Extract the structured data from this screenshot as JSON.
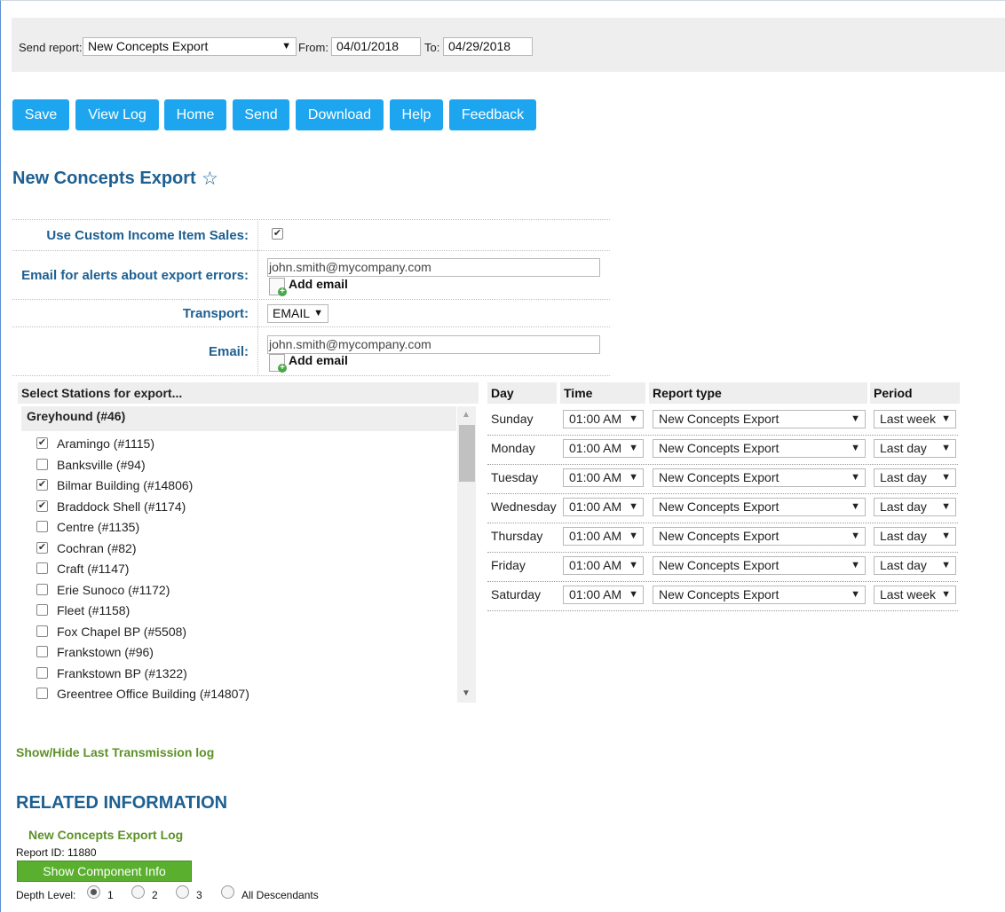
{
  "filter": {
    "send_label": "Send report:",
    "report_value": "New Concepts Export",
    "from_label": "From:",
    "from_value": "04/01/2018",
    "to_label": "To:",
    "to_value": "04/29/2018"
  },
  "toolbar": {
    "save": "Save",
    "view_log": "View Log",
    "home": "Home",
    "send": "Send",
    "download": "Download",
    "help": "Help",
    "feedback": "Feedback"
  },
  "page_title": "New Concepts Export",
  "star_glyph": "☆",
  "form": {
    "custom_income_label": "Use Custom Income Item Sales:",
    "custom_income_checked": true,
    "alert_email_label": "Email for alerts about export errors:",
    "alert_email_value": "john.smith@mycompany.com",
    "add_email": "Add email",
    "transport_label": "Transport:",
    "transport_value": "EMAIL",
    "email_label": "Email:",
    "email_value": "john.smith@mycompany.com"
  },
  "stations": {
    "header": "Select Stations for export...",
    "group": "Greyhound (#46)",
    "items": [
      {
        "label": "Aramingo (#1115)",
        "checked": true
      },
      {
        "label": "Banksville (#94)",
        "checked": false
      },
      {
        "label": "Bilmar Building (#14806)",
        "checked": true
      },
      {
        "label": "Braddock Shell (#1174)",
        "checked": true
      },
      {
        "label": "Centre (#1135)",
        "checked": false
      },
      {
        "label": "Cochran (#82)",
        "checked": true
      },
      {
        "label": "Craft (#1147)",
        "checked": false
      },
      {
        "label": "Erie Sunoco (#1172)",
        "checked": false
      },
      {
        "label": "Fleet (#1158)",
        "checked": false
      },
      {
        "label": "Fox Chapel BP (#5508)",
        "checked": false
      },
      {
        "label": "Frankstown (#96)",
        "checked": false
      },
      {
        "label": "Frankstown BP (#1322)",
        "checked": false
      },
      {
        "label": "Greentree Office Building (#14807)",
        "checked": false
      }
    ]
  },
  "schedule": {
    "headers": {
      "day": "Day",
      "time": "Time",
      "report_type": "Report type",
      "period": "Period"
    },
    "rows": [
      {
        "day": "Sunday",
        "time": "01:00 AM",
        "report": "New Concepts Export",
        "period": "Last week"
      },
      {
        "day": "Monday",
        "time": "01:00 AM",
        "report": "New Concepts Export",
        "period": "Last day"
      },
      {
        "day": "Tuesday",
        "time": "01:00 AM",
        "report": "New Concepts Export",
        "period": "Last day"
      },
      {
        "day": "Wednesday",
        "time": "01:00 AM",
        "report": "New Concepts Export",
        "period": "Last day"
      },
      {
        "day": "Thursday",
        "time": "01:00 AM",
        "report": "New Concepts Export",
        "period": "Last day"
      },
      {
        "day": "Friday",
        "time": "01:00 AM",
        "report": "New Concepts Export",
        "period": "Last day"
      },
      {
        "day": "Saturday",
        "time": "01:00 AM",
        "report": "New Concepts Export",
        "period": "Last week"
      }
    ]
  },
  "links": {
    "show_hide_log": "Show/Hide Last Transmission log"
  },
  "related": {
    "heading": "RELATED INFORMATION",
    "log_link": "New Concepts Export Log",
    "report_id": "Report ID: 11880",
    "component_button": "Show Component Info",
    "depth_label": "Depth Level:",
    "depth_options": [
      "1",
      "2",
      "3",
      "All Descendants"
    ],
    "depth_selected": "1"
  },
  "colors": {
    "button_blue": "#1da6ef",
    "heading_blue": "#1d6092",
    "link_green": "#5d9128",
    "component_green": "#5ab02e"
  }
}
